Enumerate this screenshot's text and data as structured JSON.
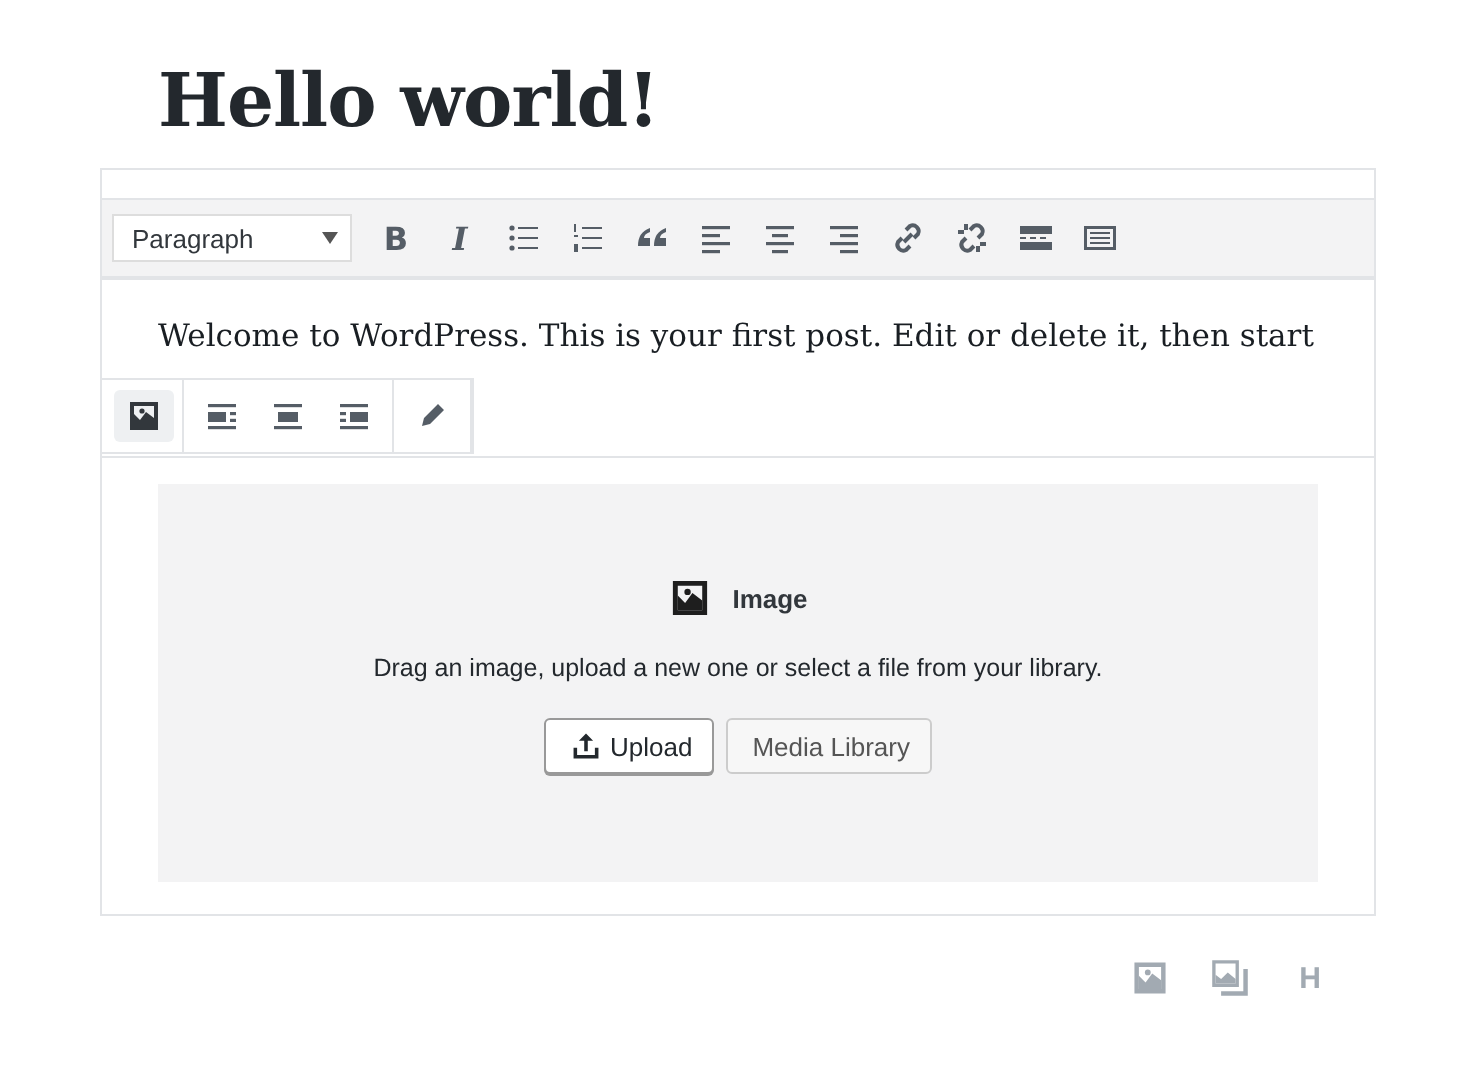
{
  "post_title": "Hello world!",
  "format_select": {
    "value": "Paragraph"
  },
  "toolbar": [
    {
      "kind": "bold",
      "label": "B"
    },
    {
      "kind": "italic",
      "label": "I"
    }
  ],
  "paragraph": "Welcome to WordPress. This is your first post. Edit or delete it, then start",
  "block_toolbar": [
    [
      {
        "selected": true
      }
    ],
    [
      {
        "selected": false
      },
      {
        "selected": false
      },
      {
        "selected": false
      }
    ],
    [
      {
        "selected": false
      }
    ]
  ],
  "image_placeholder": {
    "title": "Image",
    "instructions": "Drag an image, upload a new one or select a file from your library.",
    "buttons": [
      {
        "label": "Upload",
        "kind": "upload"
      },
      {
        "label": "Media Library",
        "kind": "plain"
      }
    ]
  },
  "inserter": {
    "heading_label": "H"
  }
}
